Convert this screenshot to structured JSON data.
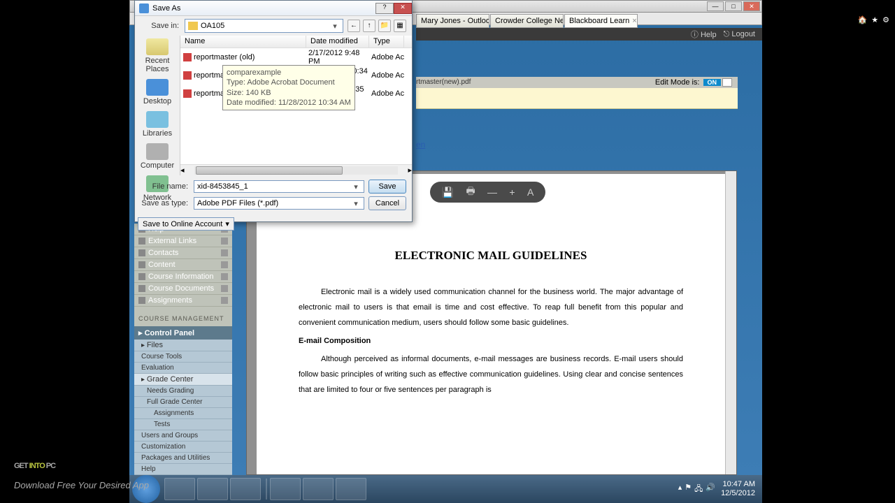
{
  "window": {
    "min": "—",
    "max": "□",
    "close": "✕"
  },
  "tabs": [
    {
      "label": "Mary Jones - Outlook Web..."
    },
    {
      "label": "Crowder College Neosho ..."
    },
    {
      "label": "Blackboard Learn"
    }
  ],
  "titlebar": {
    "help": "Help",
    "logout": "Logout",
    "home": "🏠",
    "star": "★",
    "gear": "⚙"
  },
  "content_path": "rtmaster(new).pdf",
  "edit_mode": {
    "label": "Edit Mode is:",
    "state": "ON"
  },
  "file_link": "en",
  "pdf": {
    "title": "ELECTRONIC MAIL GUIDELINES",
    "p1": "Electronic mail is a widely used communication channel for the business world.  The major advantage of electronic mail to users is that email is time and cost effective.  To reap full benefit from this popular and convenient communication medium, users should follow some basic guidelines.",
    "sub": "E-mail Composition",
    "p2": "Although perceived as informal documents, e-mail messages are business records.  E-mail users should follow basic principles of writing such as effective communication guidelines.  Using clear and concise sentences that are limited to four or five sentences per paragraph is"
  },
  "pdf_tb": {
    "save": "💾",
    "print": "🖶",
    "minus": "—",
    "plus": "+",
    "adobe": "A"
  },
  "sidebar": {
    "items": [
      "Help",
      "External Links",
      "Contacts",
      "Content",
      "Course Information",
      "Course Documents",
      "Assignments"
    ],
    "cm": "COURSE MANAGEMENT",
    "cp": "Control Panel",
    "cp_items": [
      "Files",
      "Course Tools",
      "Evaluation",
      "Grade Center"
    ],
    "gc_sub": [
      "Needs Grading",
      "Full Grade Center",
      "Assignments",
      "Tests"
    ],
    "cp_items2": [
      "Users and Groups",
      "Customization",
      "Packages and Utilities",
      "Help"
    ]
  },
  "saveas": {
    "title": "Save As",
    "savein_label": "Save in:",
    "savein_value": "OA105",
    "nav": {
      "back": "←",
      "up": "↑",
      "new": "📁",
      "view": "▦"
    },
    "headers": {
      "name": "Name",
      "date": "Date modified",
      "type": "Type"
    },
    "files": [
      {
        "name": "reportmaster (old)",
        "date": "2/17/2012 9:48 PM",
        "type": "Adobe Ac"
      },
      {
        "name": "reportmaster",
        "date": "11/28/2012 10:34 ...",
        "type": "Adobe Ac"
      },
      {
        "name": "reportmaster",
        "date": "12/5/2012 10:35 AM",
        "type": "Adobe Ac"
      }
    ],
    "tooltip": {
      "l1": "comparexample",
      "l2": "Type: Adobe Acrobat Document",
      "l3": "Size: 140 KB",
      "l4": "Date modified: 11/28/2012 10:34 AM"
    },
    "places": [
      "Recent Places",
      "Desktop",
      "Libraries",
      "Computer",
      "Network"
    ],
    "filename_label": "File name:",
    "filename_value": "xid-8453845_1",
    "type_label": "Save as type:",
    "type_value": "Adobe PDF Files (*.pdf)",
    "save_btn": "Save",
    "cancel_btn": "Cancel",
    "online": "Save to Online Account"
  },
  "taskbar": {
    "time": "10:47 AM",
    "date": "12/5/2012"
  },
  "watermark": {
    "g": "GET ",
    "i": "INTO",
    "p": " PC",
    "sub": "Download Free Your Desired App"
  }
}
